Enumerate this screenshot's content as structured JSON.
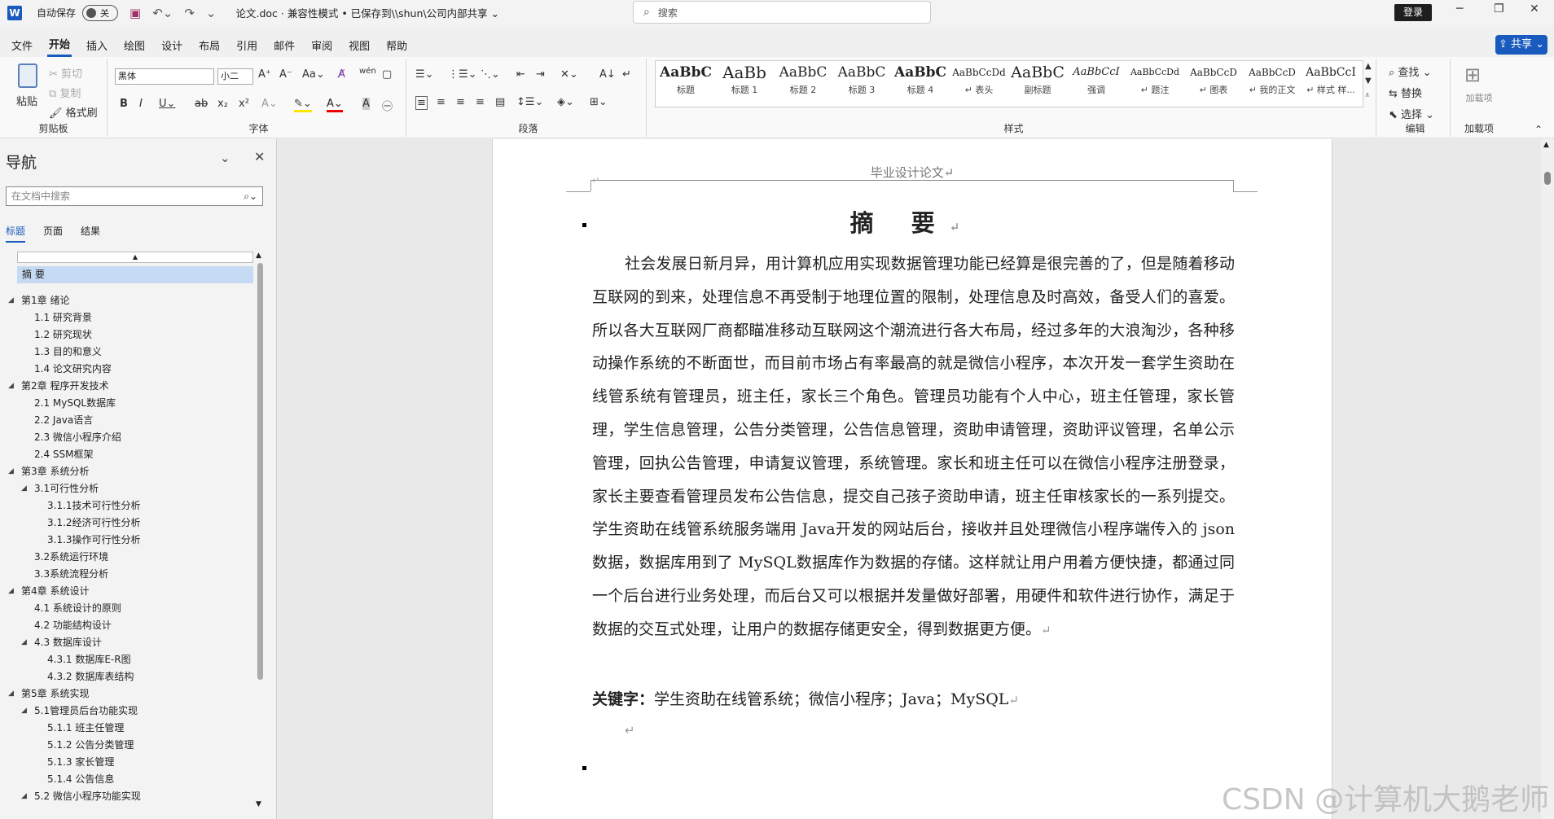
{
  "titlebar": {
    "logo": "W",
    "autosave_label": "自动保存",
    "autosave_state": "关",
    "doc_title": "论文.doc  ·  兼容性模式 • 已保存到\\\\shun\\公司内部共享 ⌄",
    "search_placeholder": "搜索",
    "login": "登录",
    "min": "─",
    "restore": "❐",
    "close": "✕"
  },
  "menu": {
    "tabs": [
      "文件",
      "开始",
      "插入",
      "绘图",
      "设计",
      "布局",
      "引用",
      "邮件",
      "审阅",
      "视图",
      "帮助"
    ],
    "share": "⇪ 共享 ⌄"
  },
  "ribbon": {
    "clipboard": {
      "label": "剪贴板",
      "paste": "粘贴",
      "cut": "剪切",
      "copy": "复制",
      "format_painter": "格式刷"
    },
    "font": {
      "label": "字体",
      "font_name": "黑体",
      "font_size": "小二"
    },
    "paragraph": {
      "label": "段落"
    },
    "styles": {
      "label": "样式",
      "items": [
        {
          "sample": "AaBbC",
          "name": "标题"
        },
        {
          "sample": "AaBb",
          "name": "标题 1"
        },
        {
          "sample": "AaBbC",
          "name": "标题 2"
        },
        {
          "sample": "AaBbC",
          "name": "标题 3"
        },
        {
          "sample": "AaBbC",
          "name": "标题 4"
        },
        {
          "sample": "AaBbCcDd",
          "name": "↵ 表头"
        },
        {
          "sample": "AaBbC",
          "name": "副标题"
        },
        {
          "sample": "AaBbCcI",
          "name": "强调"
        },
        {
          "sample": "AaBbCcDd",
          "name": "↵ 题注"
        },
        {
          "sample": "AaBbCcD",
          "name": "↵ 图表"
        },
        {
          "sample": "AaBbCcD",
          "name": "↵ 我的正文"
        },
        {
          "sample": "AaBbCcI",
          "name": "↵ 样式 样..."
        }
      ]
    },
    "editing": {
      "label": "编辑",
      "find": "查找",
      "replace": "替换",
      "select": "选择"
    },
    "addins": {
      "label": "加载项",
      "btn": "加载项"
    }
  },
  "nav": {
    "title": "导航",
    "search_placeholder": "在文档中搜索",
    "tabs": [
      "标题",
      "页面",
      "结果"
    ],
    "items": [
      {
        "text": "摘  要",
        "level": 0,
        "arrow": "",
        "selected": true
      },
      {
        "text": "第1章 绪论",
        "level": 0,
        "arrow": "◢"
      },
      {
        "text": "1.1 研究背景",
        "level": 1,
        "arrow": ""
      },
      {
        "text": "1.2 研究现状",
        "level": 1,
        "arrow": ""
      },
      {
        "text": "1.3 目的和意义",
        "level": 1,
        "arrow": ""
      },
      {
        "text": "1.4 论文研究内容",
        "level": 1,
        "arrow": ""
      },
      {
        "text": "第2章 程序开发技术",
        "level": 0,
        "arrow": "◢"
      },
      {
        "text": "2.1 MySQL数据库",
        "level": 1,
        "arrow": ""
      },
      {
        "text": "2.2 Java语言",
        "level": 1,
        "arrow": ""
      },
      {
        "text": "2.3 微信小程序介绍",
        "level": 1,
        "arrow": ""
      },
      {
        "text": "2.4 SSM框架",
        "level": 1,
        "arrow": ""
      },
      {
        "text": "第3章 系统分析",
        "level": 0,
        "arrow": "◢"
      },
      {
        "text": "3.1可行性分析",
        "level": 1,
        "arrow": "◢"
      },
      {
        "text": "3.1.1技术可行性分析",
        "level": 2,
        "arrow": ""
      },
      {
        "text": "3.1.2经济可行性分析",
        "level": 2,
        "arrow": ""
      },
      {
        "text": "3.1.3操作可行性分析",
        "level": 2,
        "arrow": ""
      },
      {
        "text": "3.2系统运行环境",
        "level": 1,
        "arrow": ""
      },
      {
        "text": "3.3系统流程分析",
        "level": 1,
        "arrow": ""
      },
      {
        "text": "第4章 系统设计",
        "level": 0,
        "arrow": "◢"
      },
      {
        "text": "4.1 系统设计的原则",
        "level": 1,
        "arrow": ""
      },
      {
        "text": "4.2 功能结构设计",
        "level": 1,
        "arrow": ""
      },
      {
        "text": "4.3 数据库设计",
        "level": 1,
        "arrow": "◢"
      },
      {
        "text": "4.3.1 数据库E-R图",
        "level": 2,
        "arrow": ""
      },
      {
        "text": "4.3.2 数据库表结构",
        "level": 2,
        "arrow": ""
      },
      {
        "text": "第5章 系统实现",
        "level": 0,
        "arrow": "◢"
      },
      {
        "text": "5.1管理员后台功能实现",
        "level": 1,
        "arrow": "◢"
      },
      {
        "text": "5.1.1 班主任管理",
        "level": 2,
        "arrow": ""
      },
      {
        "text": "5.1.2 公告分类管理",
        "level": 2,
        "arrow": ""
      },
      {
        "text": "5.1.3 家长管理",
        "level": 2,
        "arrow": ""
      },
      {
        "text": "5.1.4 公告信息",
        "level": 2,
        "arrow": ""
      },
      {
        "text": "5.2 微信小程序功能实现",
        "level": 1,
        "arrow": "◢"
      }
    ]
  },
  "document": {
    "header": "毕业设计论文↵",
    "title": "摘  要",
    "body": "社会发展日新月异，用计算机应用实现数据管理功能已经算是很完善的了，但是随着移动互联网的到来，处理信息不再受制于地理位置的限制，处理信息及时高效，备受人们的喜爱。所以各大互联网厂商都瞄准移动互联网这个潮流进行各大布局，经过多年的大浪淘沙，各种移动操作系统的不断面世，而目前市场占有率最高的就是微信小程序，本次开发一套学生资助在线管系统有管理员，班主任，家长三个角色。管理员功能有个人中心，班主任管理，家长管理，学生信息管理，公告分类管理，公告信息管理，资助申请管理，资助评议管理，名单公示管理，回执公告管理，申请复议管理，系统管理。家长和班主任可以在微信小程序注册登录，家长主要查看管理员发布公告信息，提交自己孩子资助申请，班主任审核家长的一系列提交。学生资助在线管系统服务端用 Java开发的网站后台，接收并且处理微信小程序端传入的 json 数据，数据库用到了 MySQL数据库作为数据的存储。这样就让用户用着方便快捷，都通过同一个后台进行业务处理，而后台又可以根据并发量做好部署，用硬件和软件进行协作，满足于数据的交互式处理，让用户的数据存储更安全，得到数据更方便。",
    "keywords_label": "关键字：",
    "keywords": "学生资助在线管系统；微信小程序；Java；MySQL",
    "para_mark": "↵"
  },
  "watermark": "CSDN @计算机大鹅老师"
}
